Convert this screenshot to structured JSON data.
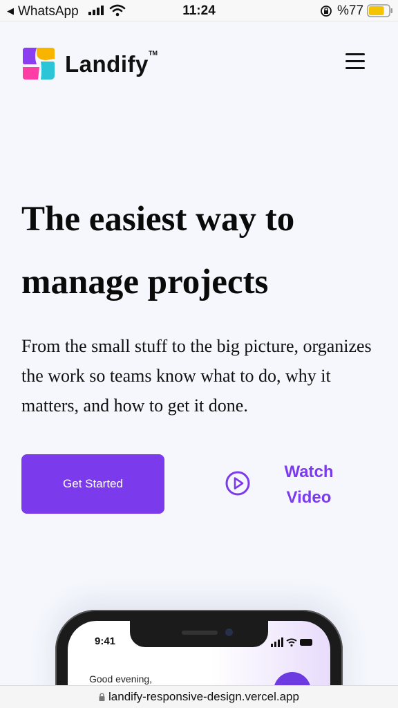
{
  "status_bar": {
    "back_app": "WhatsApp",
    "time": "11:24",
    "battery_percent": "%77",
    "battery_level": 0.77,
    "battery_color": "#f5c400"
  },
  "nav": {
    "brand": "Landify",
    "trademark": "TM",
    "logo_colors": [
      "#f7b500",
      "#2cc5d8",
      "#8b3df0",
      "#ff3ea5"
    ],
    "menu_icon": "hamburger-menu-icon"
  },
  "hero": {
    "title_line1": "The easiest way to",
    "title_line2": "manage projects",
    "subtitle": "From the small stuff to the big picture, organizes the work so teams know what to do, why it matters, and how to get it done.",
    "cta_label": "Get Started",
    "watch_line1": "Watch",
    "watch_line2": "Video",
    "accent_color": "#7c3aed",
    "play_icon": "play-circle-icon"
  },
  "phone_mockup": {
    "time": "9:41",
    "greeting": "Good evening,"
  },
  "browser": {
    "url": "landify-responsive-design.vercel.app",
    "lock_icon": "lock-icon"
  }
}
